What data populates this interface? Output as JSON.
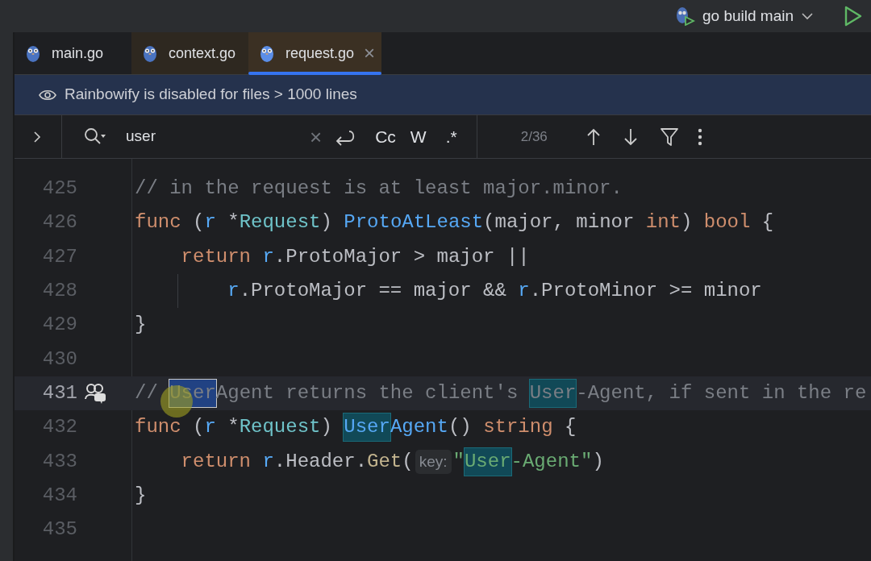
{
  "toolbar": {
    "run_config": "go build main"
  },
  "tabs": [
    {
      "label": "main.go",
      "selected": false,
      "library": false
    },
    {
      "label": "context.go",
      "selected": false,
      "library": true
    },
    {
      "label": "request.go",
      "selected": true,
      "library": true,
      "close": "×"
    }
  ],
  "banner": {
    "text": "Rainbowify is disabled for files > 1000 lines"
  },
  "search": {
    "value": "user",
    "clear": "×",
    "match_case": "Cc",
    "words": "W",
    "regex": ".*",
    "count": "2/36"
  },
  "editor": {
    "lines": [
      {
        "number": "425",
        "current": false,
        "tokens": [
          {
            "kind": "comment",
            "text": "// in the request is at least major.minor."
          }
        ]
      },
      {
        "number": "426",
        "current": false,
        "tokens": [
          {
            "kind": "keyword",
            "text": "func"
          },
          {
            "kind": "plain",
            "text": " ("
          },
          {
            "kind": "param",
            "text": "r"
          },
          {
            "kind": "plain",
            "text": " *"
          },
          {
            "kind": "type",
            "text": "Request"
          },
          {
            "kind": "plain",
            "text": ") "
          },
          {
            "kind": "function",
            "text": "ProtoAtLeast"
          },
          {
            "kind": "plain",
            "text": "(major, minor "
          },
          {
            "kind": "keyword",
            "text": "int"
          },
          {
            "kind": "plain",
            "text": ") "
          },
          {
            "kind": "keyword",
            "text": "bool"
          },
          {
            "kind": "plain",
            "text": " {"
          }
        ]
      },
      {
        "number": "427",
        "current": false,
        "tokens": [
          {
            "kind": "keyword",
            "text": "    return "
          },
          {
            "kind": "param",
            "text": "r"
          },
          {
            "kind": "plain",
            "text": ".ProtoMajor > major ||"
          }
        ]
      },
      {
        "number": "428",
        "current": false,
        "guide": true,
        "tokens": [
          {
            "kind": "param",
            "text": "        r"
          },
          {
            "kind": "plain",
            "text": ".ProtoMajor == major && "
          },
          {
            "kind": "param",
            "text": "r"
          },
          {
            "kind": "plain",
            "text": ".ProtoMinor >= minor"
          }
        ]
      },
      {
        "number": "429",
        "current": false,
        "tokens": [
          {
            "kind": "plain",
            "text": "}"
          }
        ]
      },
      {
        "number": "430",
        "current": false
      },
      {
        "number": "431",
        "current": true,
        "comment_icon": true,
        "tokens": [
          {
            "kind": "comment",
            "text": "// "
          },
          {
            "kind": "comment",
            "text": "User",
            "match": true,
            "selected": true
          },
          {
            "kind": "comment",
            "text": "Agent returns the client's "
          },
          {
            "kind": "comment",
            "text": "User",
            "match": true,
            "selected": false
          },
          {
            "kind": "comment",
            "text": "-Agent, if sent in the re"
          }
        ]
      },
      {
        "number": "432",
        "current": false,
        "tokens": [
          {
            "kind": "keyword",
            "text": "func"
          },
          {
            "kind": "plain",
            "text": " ("
          },
          {
            "kind": "param",
            "text": "r"
          },
          {
            "kind": "plain",
            "text": " *"
          },
          {
            "kind": "type",
            "text": "Request"
          },
          {
            "kind": "plain",
            "text": ") "
          },
          {
            "kind": "function",
            "text": "User",
            "match": true,
            "selected": false
          },
          {
            "kind": "function",
            "text": "Agent"
          },
          {
            "kind": "plain",
            "text": "() "
          },
          {
            "kind": "keyword",
            "text": "string"
          },
          {
            "kind": "plain",
            "text": " {"
          }
        ]
      },
      {
        "number": "433",
        "current": false,
        "tokens": [
          {
            "kind": "keyword",
            "text": "    return "
          },
          {
            "kind": "param",
            "text": "r"
          },
          {
            "kind": "plain",
            "text": ".Header."
          },
          {
            "kind": "method",
            "text": "Get"
          },
          {
            "kind": "plain",
            "text": "("
          },
          {
            "kind": "hint",
            "text": "key:"
          },
          {
            "kind": "string",
            "text": "\""
          },
          {
            "kind": "string",
            "text": "User",
            "match": true,
            "selected": false
          },
          {
            "kind": "string",
            "text": "-Agent\""
          },
          {
            "kind": "plain",
            "text": ")"
          }
        ]
      },
      {
        "number": "434",
        "current": false,
        "tokens": [
          {
            "kind": "plain",
            "text": "}"
          }
        ]
      },
      {
        "number": "435",
        "current": false
      }
    ]
  }
}
